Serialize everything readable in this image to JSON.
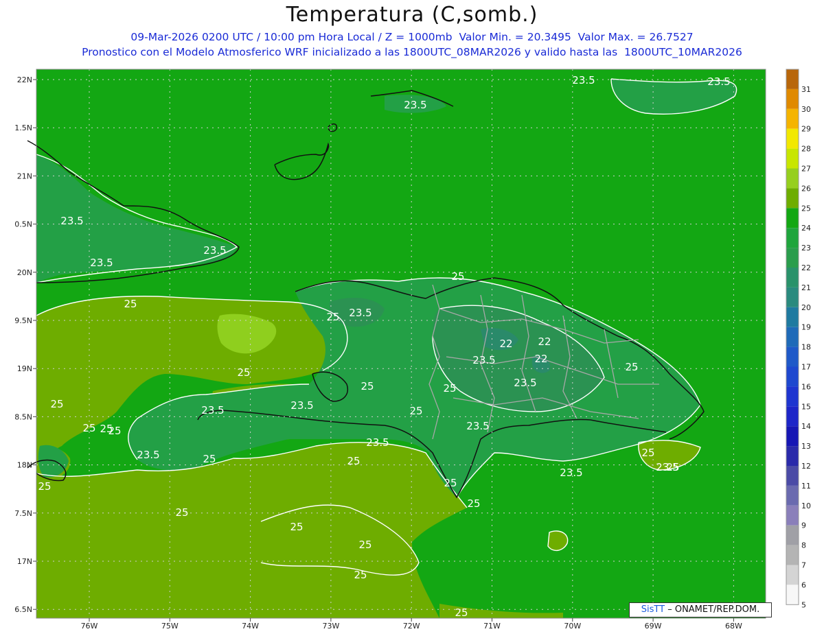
{
  "header": {
    "title": "Temperatura (C,somb.)",
    "line1": "09-Mar-2026 0200 UTC / 10:00 pm Hora Local / Z = 1000mb  Valor Min. = 20.3495  Valor Max. = 26.7527",
    "line2": "Pronostico con el Modelo Atmosferico WRF inicializado a las 1800UTC_08MAR2026 y valido hasta las  1800UTC_10MAR2026"
  },
  "credit": {
    "logo": "SisTT",
    "text": "– ONAMET/REP.DOM."
  },
  "axes": {
    "lon_labels": [
      "76W",
      "75W",
      "74W",
      "73W",
      "72W",
      "71W",
      "70W",
      "69W",
      "68W"
    ],
    "lat_labels": [
      "22N",
      "1.5N",
      "21N",
      "0.5N",
      "20N",
      "9.5N",
      "19N",
      "8.5N",
      "18N",
      "7.5N",
      "17N",
      "6.5N"
    ]
  },
  "colorbar": {
    "levels": [
      "31",
      "30",
      "29",
      "28",
      "27",
      "26",
      "25",
      "24",
      "23",
      "22",
      "21",
      "20",
      "19",
      "18",
      "17",
      "16",
      "15",
      "14",
      "13",
      "12",
      "11",
      "10",
      "9",
      "8",
      "7",
      "6",
      "5"
    ],
    "colors": [
      "#b8660a",
      "#e08a00",
      "#f5b400",
      "#f2e800",
      "#c8e600",
      "#96cf1e",
      "#6ead00",
      "#13a713",
      "#1fa53c",
      "#2a9d4c",
      "#29926a",
      "#2a8a7e",
      "#1f7aa0",
      "#1f6ab8",
      "#1f59c8",
      "#1e48cf",
      "#1e35d0",
      "#1d25c8",
      "#1616b4",
      "#2a2aaa",
      "#4b4ba6",
      "#6a6aaf",
      "#8a7fba",
      "#a0a0a6",
      "#b4b4b4",
      "#d4d4d4",
      "#f7f7f7"
    ]
  },
  "map_colors": {
    "ocean_24": "#13a713",
    "warm_25": "#6ead00",
    "warm_26": "#8fcf1e",
    "cool_23": "#23a046",
    "cool_22": "#2b9252",
    "cool_21": "#2a8a6a"
  },
  "contour_labels": [
    "23.5",
    "23.5",
    "23.5",
    "23.5",
    "23.5",
    "23.5",
    "25",
    "25",
    "23.5",
    "25",
    "22",
    "22",
    "22",
    "23.5",
    "23.5",
    "25",
    "25",
    "23.5",
    "25",
    "25",
    "23.5",
    "25",
    "23.5",
    "23.5",
    "25",
    "25",
    "23.5",
    "25",
    "25",
    "23.5",
    "25",
    "23.5",
    "25",
    "25",
    "25",
    "25",
    "25",
    "25",
    "25",
    "25",
    "25",
    "25",
    "25"
  ]
}
